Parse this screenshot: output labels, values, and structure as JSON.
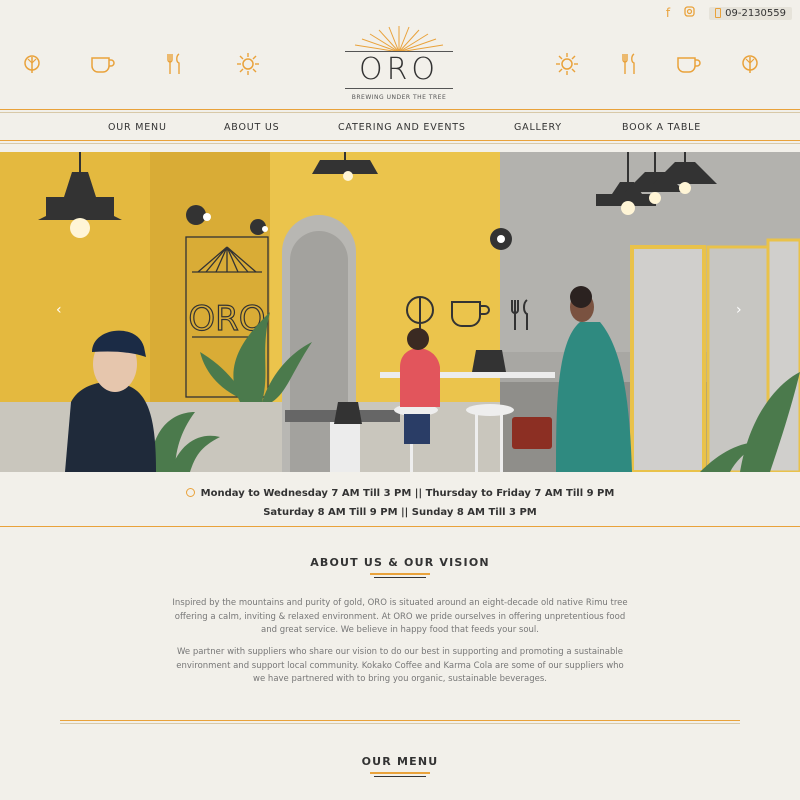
{
  "topbar": {
    "facebook_icon": "facebook-icon",
    "instagram_icon": "instagram-icon",
    "phone": "09-2130559"
  },
  "logo": {
    "name": "ORO",
    "tagline": "BREWING UNDER THE TREE"
  },
  "nav": {
    "items": [
      "OUR MENU",
      "ABOUT US",
      "CATERING AND EVENTS",
      "GALLERY",
      "BOOK A TABLE"
    ]
  },
  "hero": {
    "wall_sign": "ORO"
  },
  "hours": {
    "line1": "Monday to Wednesday 7 AM Till 3 PM || Thursday to Friday 7 AM Till 9 PM",
    "line2": "Saturday 8 AM Till 9 PM || Sunday 8 AM Till 3 PM"
  },
  "about": {
    "title": "ABOUT US & OUR VISION",
    "p1": "Inspired by the mountains and purity of gold, ORO is situated around an eight-decade old native Rimu tree offering a calm, inviting & relaxed environment. At ORO we pride ourselves in offering unpretentious food and great service. We believe in happy food that feeds your soul.",
    "p2": "We partner with suppliers who share our vision to do our best in supporting and promoting a sustainable environment and support local community. Kokako Coffee and Karma Cola are some of our suppliers who we have partnered with to bring you organic, sustainable beverages."
  },
  "menu": {
    "title": "OUR MENU"
  },
  "colors": {
    "accent": "#e9a23b",
    "background": "#f2f0ea",
    "wall_yellow": "#e9c24a"
  }
}
